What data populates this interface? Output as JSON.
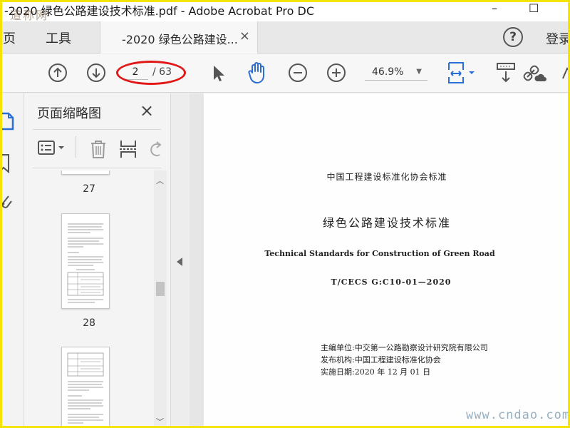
{
  "window": {
    "title": "-2020 绿色公路建设技术标准.pdf - Adobe Acrobat Pro DC",
    "watermark_top": "道称网",
    "minimize": "–",
    "maximize": "☐"
  },
  "tabs": {
    "home": "主页",
    "tools": "工具",
    "document": "-2020 绿色公路建设...",
    "close": "×",
    "help": "?",
    "login": "登录"
  },
  "toolbar": {
    "current_page": "2",
    "total_pages": "/ 63",
    "zoom": "46.9%"
  },
  "panel": {
    "title": "页面缩略图",
    "close": "×",
    "thumbnails": [
      {
        "number": "27"
      },
      {
        "number": "28"
      },
      {
        "number": ""
      }
    ]
  },
  "document": {
    "org_line": "中国工程建设标准化协会标准",
    "title_cn": "绿色公路建设技术标准",
    "title_en": "Technical Standards for Construction of Green Road",
    "code": "T/CECS G:C10-01—2020",
    "editor": "主编单位:中交第一公路勘察设计研究院有限公司",
    "publisher": "发布机构:中国工程建设标准化协会",
    "date": "实施日期:2020 年 12 月 01 日"
  },
  "watermark_bottom": "www.cndao.com",
  "colors": {
    "accent_blue": "#2b6fd6",
    "highlight_red": "#e01818",
    "border_yellow": "#f4e400"
  }
}
